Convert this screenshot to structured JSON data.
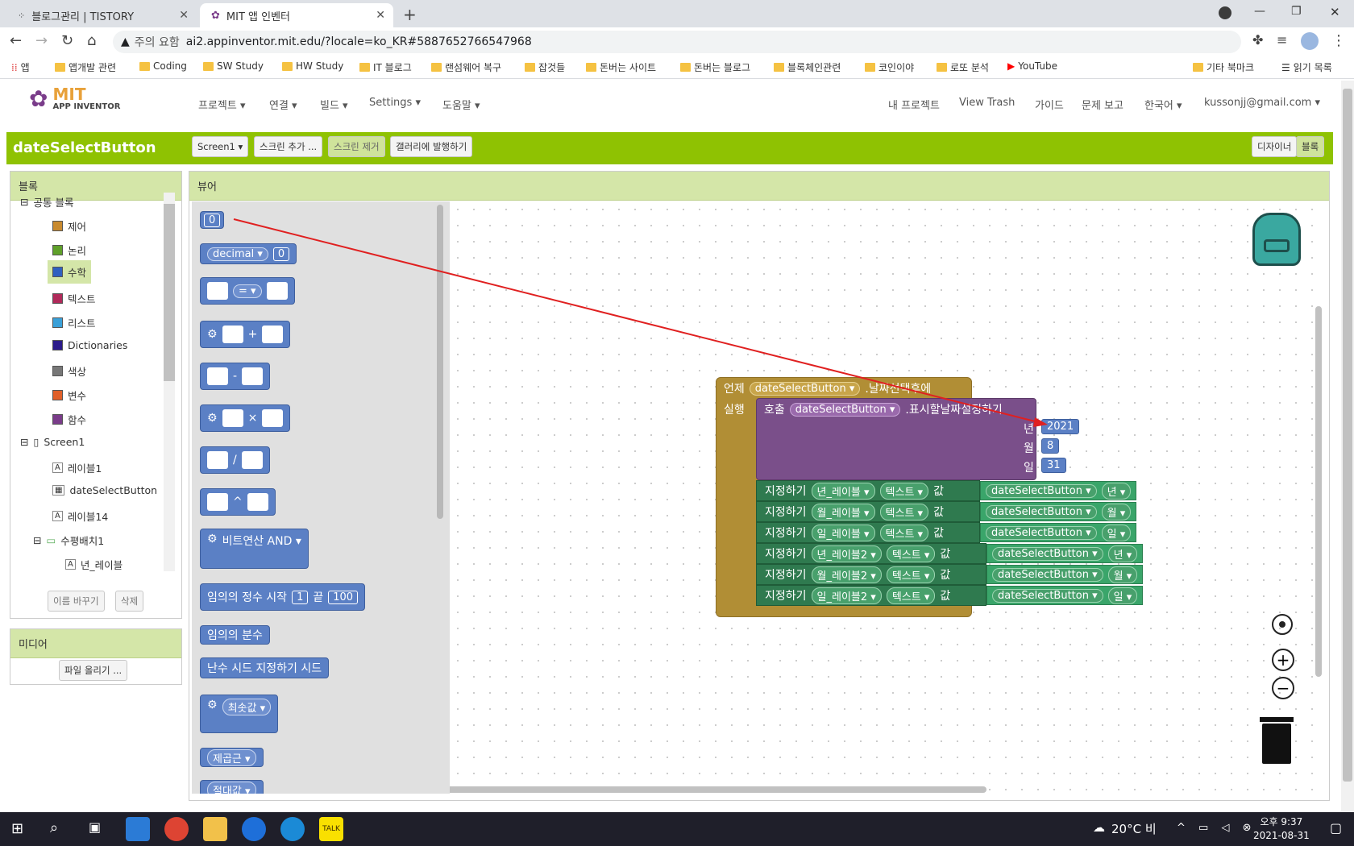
{
  "browser": {
    "tabs": [
      {
        "label": "블로그관리 | TISTORY"
      },
      {
        "label": "MIT 앱 인벤터"
      }
    ],
    "warning": "주의 요함",
    "url": "ai2.appinventor.mit.edu/?locale=ko_KR#5887652766547968",
    "bookmarks": [
      "앱",
      "앱개발 관련",
      "Coding",
      "SW Study",
      "HW Study",
      "IT 블로그",
      "랜섬웨어 복구",
      "잡것들",
      "돈버는 사이트",
      "돈버는 블로그",
      "블록체인관련",
      "코인이야",
      "로또 분석",
      "YouTube",
      "기타 북마크",
      "읽기 목록"
    ]
  },
  "app": {
    "logo_top": "MIT",
    "logo_bottom": "APP INVENTOR",
    "menus": [
      "프로젝트 ▾",
      "연결 ▾",
      "빌드 ▾",
      "Settings ▾",
      "도움말 ▾"
    ],
    "right_menus": [
      "내 프로젝트",
      "View Trash",
      "가이드",
      "문제 보고",
      "한국어 ▾",
      "kussonjj@gmail.com ▾"
    ],
    "project_title": "dateSelectButton",
    "screen_select": "Screen1 ▾",
    "add_screen": "스크린 추가 ...",
    "remove_screen": "스크린 제거",
    "publish": "갤러리에 발행하기",
    "designer": "디자이너",
    "blocks_btn": "블록"
  },
  "blocks_panel": {
    "title": "블록",
    "builtin": "공통 블록",
    "categories": [
      {
        "label": "제어",
        "color": "#c88a2f"
      },
      {
        "label": "논리",
        "color": "#5fa02a"
      },
      {
        "label": "수학",
        "color": "#2f5fc0"
      },
      {
        "label": "텍스트",
        "color": "#b02a5a"
      },
      {
        "label": "리스트",
        "color": "#3aa0d8"
      },
      {
        "label": "Dictionaries",
        "color": "#2b1a8a"
      },
      {
        "label": "색상",
        "color": "#777777"
      },
      {
        "label": "변수",
        "color": "#e0602a"
      },
      {
        "label": "함수",
        "color": "#7a3c8a"
      }
    ],
    "screen": "Screen1",
    "components": [
      "레이블1",
      "dateSelectButton",
      "레이블14",
      "수평배치1",
      "년_레이블"
    ],
    "rename": "이름 바꾸기",
    "delete": "삭제"
  },
  "media": {
    "title": "미디어",
    "upload": "파일 올리기 ..."
  },
  "viewer": {
    "title": "뷰어",
    "flyout": {
      "zero": "0",
      "decimal": "decimal ▾",
      "decimal_val": "0",
      "eq": "= ▾",
      "plus": "+",
      "minus": "-",
      "times": "×",
      "div": "/",
      "pow": "^",
      "bitwise": "비트연산  AND ▾",
      "random_int": "임의의 정수 시작",
      "random_from": "1",
      "random_to_label": "끝",
      "random_to": "100",
      "random_frac": "임의의 분수",
      "seed": "난수 시드 지정하기 시드",
      "min": "최솟값 ▾",
      "sqrt": "제곱근 ▾",
      "abs": "절대값 ▾"
    },
    "event": {
      "when": "언제",
      "component": "dateSelectButton ▾",
      "event_name": ".날짜선택후에",
      "do": "실행",
      "call": "호출",
      "call_component": "dateSelectButton ▾",
      "method": ".표시할날짜설정하기",
      "year_label": "년",
      "year": "2021",
      "month_label": "월",
      "month": "8",
      "day_label": "일",
      "day": "31",
      "sets": [
        {
          "target": "년_레이블 ▾",
          "prop": "텍스트 ▾",
          "src": "dateSelectButton ▾",
          "field": "년 ▾"
        },
        {
          "target": "월_레이블 ▾",
          "prop": "텍스트 ▾",
          "src": "dateSelectButton ▾",
          "field": "월 ▾"
        },
        {
          "target": "일_레이블 ▾",
          "prop": "텍스트 ▾",
          "src": "dateSelectButton ▾",
          "field": "일 ▾"
        },
        {
          "target": "년_레이블2 ▾",
          "prop": "텍스트 ▾",
          "src": "dateSelectButton ▾",
          "field": "년 ▾"
        },
        {
          "target": "월_레이블2 ▾",
          "prop": "텍스트 ▾",
          "src": "dateSelectButton ▾",
          "field": "월 ▾"
        },
        {
          "target": "일_레이블2 ▾",
          "prop": "텍스트 ▾",
          "src": "dateSelectButton ▾",
          "field": "일 ▾"
        }
      ],
      "set_word": "지정하기",
      "value_word": "값"
    }
  },
  "taskbar": {
    "weather": "20°C 비",
    "time": "오후 9:37",
    "date": "2021-08-31"
  }
}
